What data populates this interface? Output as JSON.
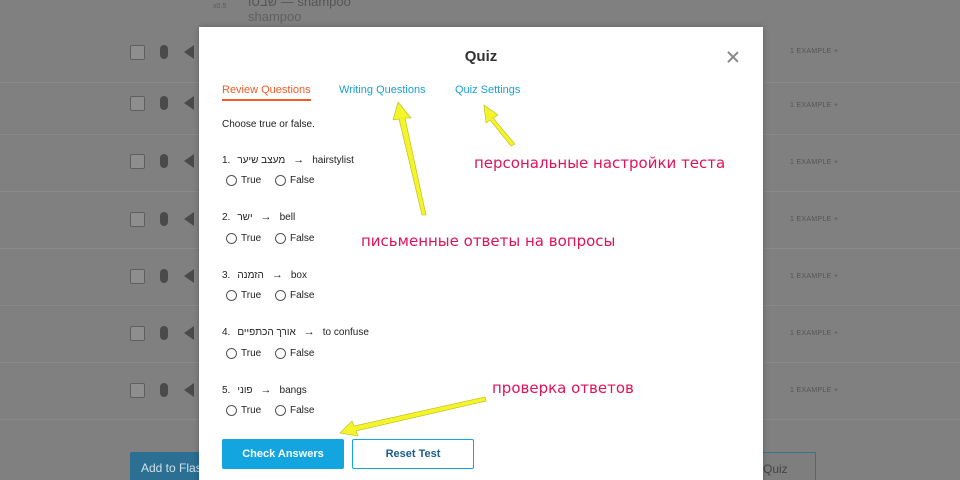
{
  "background": {
    "top_word_1": "שבסו — shampoo",
    "top_word_2": "shampoo",
    "top_small": "x0.5",
    "example_label": "1 EXAMPLE +",
    "left_button": "Add to Flas",
    "right_button": "Quiz"
  },
  "modal": {
    "title": "Quiz",
    "tabs": [
      {
        "label": "Review Questions",
        "active": true
      },
      {
        "label": "Writing Questions",
        "active": false
      },
      {
        "label": "Quiz Settings",
        "active": false
      }
    ],
    "instruction": "Choose true or false.",
    "questions": [
      {
        "num": "1.",
        "hebrew": "מעצב שיער",
        "english": "hairstylist"
      },
      {
        "num": "2.",
        "hebrew": "ישר",
        "english": "bell"
      },
      {
        "num": "3.",
        "hebrew": "הזמנה",
        "english": "box"
      },
      {
        "num": "4.",
        "hebrew": "אורך הכתפיים",
        "english": "to confuse"
      },
      {
        "num": "5.",
        "hebrew": "פוני",
        "english": "bangs"
      }
    ],
    "option_true": "True",
    "option_false": "False",
    "arrow_glyph": "→",
    "check_button": "Check Answers",
    "reset_button": "Reset Test"
  },
  "annotations": {
    "settings": "персональные настройки теста",
    "writing": "письменные ответы на вопросы",
    "check": "проверка ответов"
  },
  "colors": {
    "accent_orange": "#f25c28",
    "link_blue": "#1a9fd4",
    "button_blue": "#12a5e0",
    "annotation_pink": "#e0125a",
    "arrow_yellow": "#f4f42a"
  }
}
